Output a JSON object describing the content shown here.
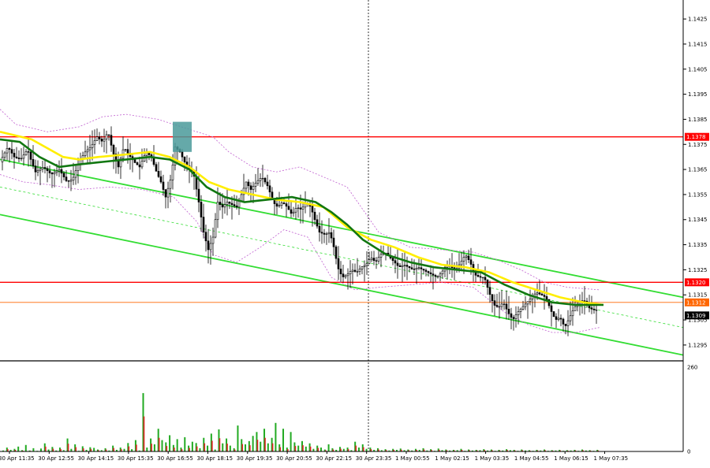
{
  "chart_data": [
    {
      "type": "candlestick",
      "ylim": [
        1.1289,
        1.1431
      ],
      "y_ticks": [
        "1.1425",
        "1.1415",
        "1.1405",
        "1.1395",
        "1.1385",
        "1.1375",
        "1.1365",
        "1.1355",
        "1.1345",
        "1.1335",
        "1.1325",
        "1.1315",
        "1.1305",
        "1.1295"
      ],
      "y_tick_values": [
        1.1425,
        1.1415,
        1.1405,
        1.1395,
        1.1385,
        1.1375,
        1.1365,
        1.1355,
        1.1345,
        1.1335,
        1.1325,
        1.1315,
        1.1305,
        1.1295
      ],
      "x_labels": [
        "30 Apr 11:35",
        "30 Apr 12:55",
        "30 Apr 14:15",
        "30 Apr 15:35",
        "30 Apr 16:55",
        "30 Apr 18:15",
        "30 Apr 19:35",
        "30 Apr 20:55",
        "30 Apr 22:15",
        "30 Apr 23:35",
        "1 May 00:55",
        "1 May 02:15",
        "1 May 03:35",
        "1 May 04:55",
        "1 May 06:15",
        "1 May 07:35"
      ],
      "close_path": [
        [
          0,
          1.1368
        ],
        [
          10,
          1.1374
        ],
        [
          18,
          1.137
        ],
        [
          26,
          1.1369
        ],
        [
          35,
          1.1373
        ],
        [
          40,
          1.1368
        ],
        [
          45,
          1.1364
        ],
        [
          55,
          1.1366
        ],
        [
          65,
          1.1363
        ],
        [
          75,
          1.1365
        ],
        [
          85,
          1.136
        ],
        [
          92,
          1.1361
        ],
        [
          100,
          1.1368
        ],
        [
          108,
          1.1372
        ],
        [
          115,
          1.1374
        ],
        [
          123,
          1.1378
        ],
        [
          130,
          1.1376
        ],
        [
          137,
          1.138
        ],
        [
          143,
          1.1372
        ],
        [
          150,
          1.1366
        ],
        [
          157,
          1.1374
        ],
        [
          163,
          1.1371
        ],
        [
          170,
          1.1368
        ],
        [
          177,
          1.1366
        ],
        [
          185,
          1.1372
        ],
        [
          192,
          1.137
        ],
        [
          197,
          1.1365
        ],
        [
          204,
          1.136
        ],
        [
          210,
          1.1354
        ],
        [
          217,
          1.1362
        ],
        [
          222,
          1.1374
        ],
        [
          228,
          1.1372
        ],
        [
          234,
          1.1368
        ],
        [
          240,
          1.1365
        ],
        [
          245,
          1.1364
        ],
        [
          252,
          1.1352
        ],
        [
          258,
          1.134
        ],
        [
          264,
          1.1333
        ],
        [
          270,
          1.1338
        ],
        [
          276,
          1.1352
        ],
        [
          282,
          1.135
        ],
        [
          288,
          1.1352
        ],
        [
          294,
          1.1351
        ],
        [
          300,
          1.135
        ],
        [
          306,
          1.1355
        ],
        [
          312,
          1.136
        ],
        [
          318,
          1.1357
        ],
        [
          325,
          1.136
        ],
        [
          332,
          1.1362
        ],
        [
          340,
          1.1358
        ],
        [
          346,
          1.1352
        ],
        [
          352,
          1.135
        ],
        [
          358,
          1.1352
        ],
        [
          364,
          1.135
        ],
        [
          370,
          1.1347
        ],
        [
          376,
          1.135
        ],
        [
          382,
          1.1349
        ],
        [
          388,
          1.1352
        ],
        [
          394,
          1.135
        ],
        [
          400,
          1.1344
        ],
        [
          405,
          1.134
        ],
        [
          412,
          1.1339
        ],
        [
          418,
          1.134
        ],
        [
          424,
          1.1333
        ],
        [
          428,
          1.1326
        ],
        [
          434,
          1.1322
        ],
        [
          440,
          1.1323
        ],
        [
          446,
          1.1325
        ],
        [
          452,
          1.1324
        ],
        [
          458,
          1.1326
        ],
        [
          464,
          1.1327
        ],
        [
          470,
          1.133
        ],
        [
          476,
          1.1328
        ],
        [
          482,
          1.1331
        ],
        [
          488,
          1.1332
        ],
        [
          494,
          1.133
        ],
        [
          500,
          1.1328
        ],
        [
          506,
          1.1326
        ],
        [
          512,
          1.1327
        ],
        [
          518,
          1.1326
        ],
        [
          524,
          1.1325
        ],
        [
          530,
          1.1326
        ],
        [
          536,
          1.1325
        ],
        [
          542,
          1.1324
        ],
        [
          548,
          1.1323
        ],
        [
          554,
          1.1322
        ],
        [
          560,
          1.1324
        ],
        [
          566,
          1.1327
        ],
        [
          572,
          1.1326
        ],
        [
          578,
          1.1325
        ],
        [
          584,
          1.1328
        ],
        [
          590,
          1.1331
        ],
        [
          596,
          1.1328
        ],
        [
          602,
          1.1323
        ],
        [
          608,
          1.1322
        ],
        [
          614,
          1.1322
        ],
        [
          620,
          1.1316
        ],
        [
          626,
          1.1311
        ],
        [
          632,
          1.131
        ],
        [
          638,
          1.1312
        ],
        [
          644,
          1.1308
        ],
        [
          650,
          1.1305
        ],
        [
          656,
          1.1308
        ],
        [
          662,
          1.131
        ],
        [
          668,
          1.1312
        ],
        [
          674,
          1.1314
        ],
        [
          680,
          1.1316
        ],
        [
          686,
          1.1315
        ],
        [
          692,
          1.1314
        ],
        [
          698,
          1.1309
        ],
        [
          704,
          1.1305
        ],
        [
          710,
          1.1306
        ],
        [
          716,
          1.1302
        ],
        [
          722,
          1.1306
        ],
        [
          728,
          1.131
        ],
        [
          734,
          1.1312
        ],
        [
          740,
          1.1313
        ],
        [
          746,
          1.131
        ],
        [
          752,
          1.1309
        ],
        [
          758,
          1.1309
        ]
      ],
      "sma_fast_path": [
        [
          0,
          1.138
        ],
        [
          40,
          1.1377
        ],
        [
          80,
          1.137
        ],
        [
          100,
          1.1369
        ],
        [
          125,
          1.137
        ],
        [
          160,
          1.1371
        ],
        [
          190,
          1.1372
        ],
        [
          215,
          1.137
        ],
        [
          240,
          1.1366
        ],
        [
          265,
          1.136
        ],
        [
          290,
          1.1357
        ],
        [
          320,
          1.1355
        ],
        [
          350,
          1.1353
        ],
        [
          380,
          1.1352
        ],
        [
          410,
          1.135
        ],
        [
          440,
          1.1342
        ],
        [
          470,
          1.1337
        ],
        [
          500,
          1.1334
        ],
        [
          530,
          1.133
        ],
        [
          560,
          1.1327
        ],
        [
          590,
          1.1326
        ],
        [
          620,
          1.1324
        ],
        [
          650,
          1.132
        ],
        [
          680,
          1.1317
        ],
        [
          710,
          1.1314
        ],
        [
          740,
          1.1312
        ],
        [
          765,
          1.1311
        ]
      ],
      "sma_slow_path": [
        [
          0,
          1.1377
        ],
        [
          25,
          1.1376
        ],
        [
          50,
          1.137
        ],
        [
          75,
          1.1366
        ],
        [
          100,
          1.1367
        ],
        [
          130,
          1.1368
        ],
        [
          160,
          1.1369
        ],
        [
          190,
          1.137
        ],
        [
          215,
          1.1369
        ],
        [
          240,
          1.1365
        ],
        [
          262,
          1.1358
        ],
        [
          285,
          1.1354
        ],
        [
          310,
          1.1352
        ],
        [
          340,
          1.1353
        ],
        [
          370,
          1.1354
        ],
        [
          400,
          1.1352
        ],
        [
          420,
          1.1348
        ],
        [
          440,
          1.1343
        ],
        [
          460,
          1.1337
        ],
        [
          490,
          1.1331
        ],
        [
          520,
          1.1328
        ],
        [
          550,
          1.1326
        ],
        [
          580,
          1.1325
        ],
        [
          610,
          1.1324
        ],
        [
          640,
          1.1319
        ],
        [
          670,
          1.1315
        ],
        [
          700,
          1.1312
        ],
        [
          730,
          1.1311
        ],
        [
          765,
          1.1311
        ]
      ],
      "bollinger_upper_path": [
        [
          0,
          1.1389
        ],
        [
          20,
          1.1383
        ],
        [
          60,
          1.138
        ],
        [
          100,
          1.1382
        ],
        [
          130,
          1.1386
        ],
        [
          160,
          1.1387
        ],
        [
          200,
          1.1385
        ],
        [
          240,
          1.1381
        ],
        [
          270,
          1.1378
        ],
        [
          290,
          1.1372
        ],
        [
          320,
          1.1366
        ],
        [
          350,
          1.1364
        ],
        [
          380,
          1.1366
        ],
        [
          410,
          1.1362
        ],
        [
          440,
          1.1358
        ],
        [
          460,
          1.1349
        ],
        [
          480,
          1.134
        ],
        [
          520,
          1.1334
        ],
        [
          560,
          1.1333
        ],
        [
          600,
          1.1332
        ],
        [
          630,
          1.1329
        ],
        [
          660,
          1.1325
        ],
        [
          690,
          1.132
        ],
        [
          720,
          1.1318
        ],
        [
          760,
          1.1317
        ]
      ],
      "bollinger_lower_path": [
        [
          0,
          1.1363
        ],
        [
          30,
          1.136
        ],
        [
          60,
          1.1359
        ],
        [
          100,
          1.1357
        ],
        [
          140,
          1.1358
        ],
        [
          180,
          1.1357
        ],
        [
          220,
          1.1354
        ],
        [
          250,
          1.1344
        ],
        [
          270,
          1.1331
        ],
        [
          300,
          1.1328
        ],
        [
          330,
          1.1334
        ],
        [
          360,
          1.1341
        ],
        [
          390,
          1.1338
        ],
        [
          420,
          1.1322
        ],
        [
          450,
          1.1317
        ],
        [
          480,
          1.1318
        ],
        [
          520,
          1.1319
        ],
        [
          560,
          1.132
        ],
        [
          600,
          1.1318
        ],
        [
          640,
          1.1308
        ],
        [
          670,
          1.1303
        ],
        [
          700,
          1.13
        ],
        [
          730,
          1.13
        ],
        [
          760,
          1.1302
        ]
      ],
      "horizontal_levels": [
        {
          "value": 1.1378,
          "label": "1.1378",
          "color": "#ff0000"
        },
        {
          "value": 1.132,
          "label": "1.1320",
          "color": "#ff0000"
        },
        {
          "value": 1.1312,
          "label": "1.1312",
          "color": "#ff6600"
        }
      ],
      "current_price_label": "1.1309",
      "channel_lines": [
        {
          "from": [
            0,
            1.1369
          ],
          "to": [
            866,
            1.1314
          ],
          "color": "#33dd33"
        },
        {
          "from": [
            0,
            1.1347
          ],
          "to": [
            866,
            1.1291
          ],
          "color": "#33dd33"
        },
        {
          "from": [
            0,
            1.1358
          ],
          "to": [
            866,
            1.1302
          ],
          "color": "#33dd33",
          "dashed": true
        }
      ],
      "entry_box": {
        "from": [
          219,
          1.1384
        ],
        "to": [
          243,
          1.1372
        ],
        "color": "#4a9a9a"
      },
      "vertical_marker_x": 467
    },
    {
      "type": "bar",
      "ylim": [
        0,
        260
      ],
      "y_ticks": [
        "260",
        "0"
      ],
      "values": [
        3,
        12,
        5,
        8,
        15,
        4,
        20,
        3,
        10,
        2,
        9,
        25,
        6,
        14,
        3,
        12,
        4,
        40,
        8,
        22,
        2,
        16,
        5,
        13,
        11,
        6,
        4,
        10,
        3,
        18,
        5,
        12,
        8,
        26,
        7,
        35,
        3,
        180,
        12,
        40,
        22,
        70,
        35,
        28,
        50,
        20,
        38,
        12,
        44,
        18,
        30,
        26,
        10,
        42,
        18,
        55,
        6,
        68,
        25,
        40,
        18,
        10,
        80,
        38,
        22,
        32,
        48,
        60,
        30,
        70,
        25,
        42,
        88,
        22,
        70,
        12,
        60,
        28,
        18,
        32,
        15,
        25,
        8,
        18,
        12,
        6,
        22,
        10,
        5,
        14,
        8,
        12,
        4,
        30,
        12,
        22,
        8,
        12,
        5,
        10,
        4,
        7,
        3,
        8,
        5,
        9,
        4,
        6,
        3,
        8,
        5,
        10,
        3,
        7,
        2,
        9,
        4,
        6,
        3,
        5,
        4,
        8,
        2,
        6,
        3,
        5,
        4,
        7,
        3,
        6,
        2,
        5,
        3,
        7,
        4,
        5,
        2,
        6,
        3,
        4,
        2,
        5,
        3,
        6,
        2,
        4,
        3,
        5,
        2,
        4,
        3,
        5,
        2,
        6,
        3,
        4,
        2,
        5
      ]
    }
  ]
}
